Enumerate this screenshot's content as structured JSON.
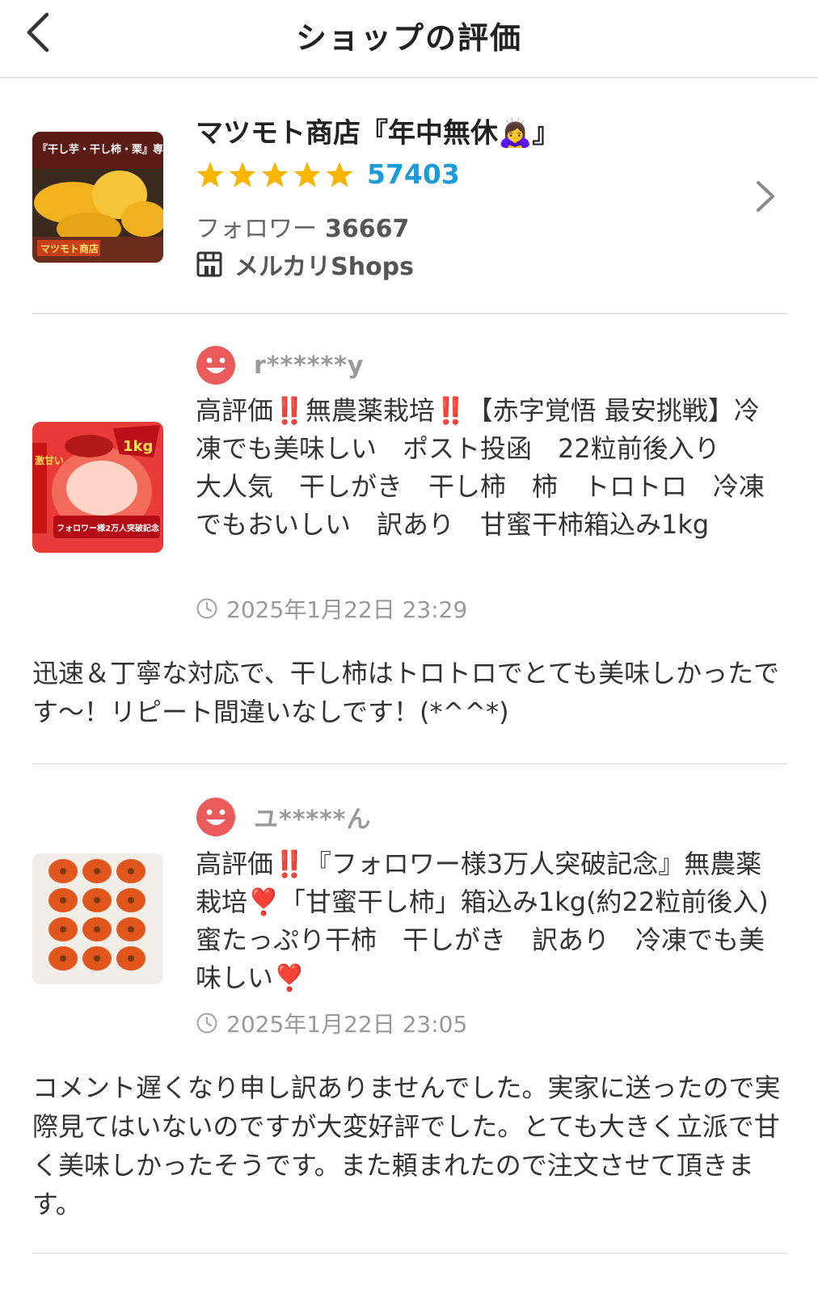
{
  "header": {
    "title": "ショップの評価"
  },
  "shop": {
    "name": "マツモト商店『年中無休🙇‍♀️』",
    "rating_count": "57403",
    "followers_label": "フォロワー",
    "followers_count": "36667",
    "platform_label": "メルカリShops",
    "thumbnail_caption": "『干し芋・干し柿・栗』専門店",
    "thumbnail_sign": "マツモト商店",
    "stars": 5
  },
  "reviews": [
    {
      "reviewer": "r******y",
      "title_segments": [
        {
          "text": "高評価",
          "mark": false
        },
        {
          "text": "‼️",
          "mark": true
        },
        {
          "text": "無農薬栽培",
          "mark": false
        },
        {
          "text": "‼️",
          "mark": true
        },
        {
          "text": "【赤字覚悟 最安挑戦】冷凍でも美味しい　ポスト投函　22粒前後入り　大人気　干しがき　干し柿　柿　トロトロ　冷凍でもおいしい　訳あり　甘蜜干柿箱込み1kg",
          "mark": false
        }
      ],
      "thumbnail_badge": "1kg",
      "thumbnail_ribbon": "フォロワー様2万人突破記念",
      "thumbnail_side": "激甘い",
      "timestamp": "2025年1月22日 23:29",
      "comment": "迅速＆丁寧な対応で、干し柿はトロトロでとても美味しかったです〜！リピート間違いなしです！(*^^*)"
    },
    {
      "reviewer": "ユ*****ん",
      "title_segments": [
        {
          "text": "高評価",
          "mark": false
        },
        {
          "text": "‼️",
          "mark": true
        },
        {
          "text": "『フォロワー様3万人突破記念』無農薬栽培",
          "mark": false
        },
        {
          "text": "❣️",
          "mark": true
        },
        {
          "text": "「甘蜜干し柿」箱込み1kg(約22粒前後入) 蜜たっぷり干柿　干しがき　訳あり　冷凍でも美味しい",
          "mark": false
        },
        {
          "text": "❣️",
          "mark": true
        }
      ],
      "timestamp": "2025年1月22日 23:05",
      "comment": "コメント遅くなり申し訳ありませんでした。実家に送ったので実際見てはいないのですが大変好評でした。とても大きく立派で甘く美味しかったそうです。また頼まれたので注文させて頂きます。"
    }
  ],
  "colors": {
    "accent_blue": "#1d9bd8",
    "star_yellow": "#f7b500",
    "smiley_red": "#ea5b5b",
    "mark_red": "#e8232a",
    "divider": "#e6e6e6"
  },
  "icons": {
    "back": "chevron-left-icon",
    "forward": "chevron-right-icon",
    "star": "star-icon",
    "shop": "shop-icon",
    "reviewer": "smiley-face-icon",
    "time": "clock-icon"
  }
}
